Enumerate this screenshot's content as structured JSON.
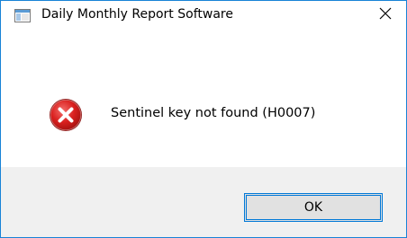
{
  "window": {
    "title": "Daily Monthly Report Software",
    "accent_color": "#1883d7",
    "app_icon": "window-icon",
    "close_icon": "close-icon"
  },
  "message": {
    "icon": "error-icon",
    "icon_color": "#d9201f",
    "text": "Sentinel key not found (H0007)"
  },
  "buttons": {
    "ok_label": "OK"
  }
}
